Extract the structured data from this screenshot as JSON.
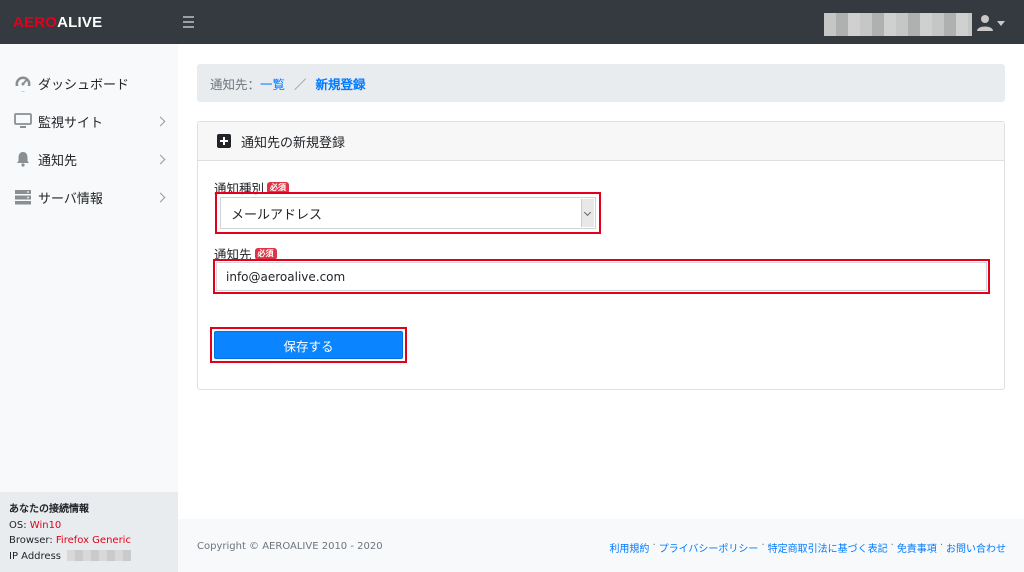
{
  "header": {
    "logo_part1": "AERO",
    "logo_part2": "ALIVE"
  },
  "sidebar": {
    "items": [
      {
        "label": "ダッシュボード",
        "icon": "tachometer-icon",
        "has_submenu": false
      },
      {
        "label": "監視サイト",
        "icon": "monitor-icon",
        "has_submenu": true
      },
      {
        "label": "通知先",
        "icon": "bell-icon",
        "has_submenu": true
      },
      {
        "label": "サーバ情報",
        "icon": "server-icon",
        "has_submenu": true
      }
    ],
    "connection": {
      "title": "あなたの接続情報",
      "os_label": "OS: ",
      "os_value": "Win10",
      "browser_label": "Browser: ",
      "browser_value": "Firefox Generic",
      "ip_label": "IP Address"
    }
  },
  "breadcrumb": {
    "prefix": "通知先：",
    "link": "一覧",
    "separator": "／",
    "current": "新規登録"
  },
  "card": {
    "title": "通知先の新規登録",
    "type_field": {
      "label": "通知種別",
      "badge": "必須",
      "selected": "メールアドレス"
    },
    "destination_field": {
      "label": "通知先",
      "badge": "必須",
      "value": "info@aeroalive.com"
    },
    "save_label": "保存する"
  },
  "footer": {
    "copyright": "Copyright © AEROALIVE 2010 - 2020",
    "links": [
      "利用規約",
      "プライバシーポリシー",
      "特定商取引法に基づく表記",
      "免責事項",
      "お問い合わせ"
    ],
    "link_separator": "·"
  },
  "colors": {
    "accent": "#007bff",
    "brand_red": "#e3001b",
    "topbar": "#343a40",
    "button": "#0a84ff"
  }
}
